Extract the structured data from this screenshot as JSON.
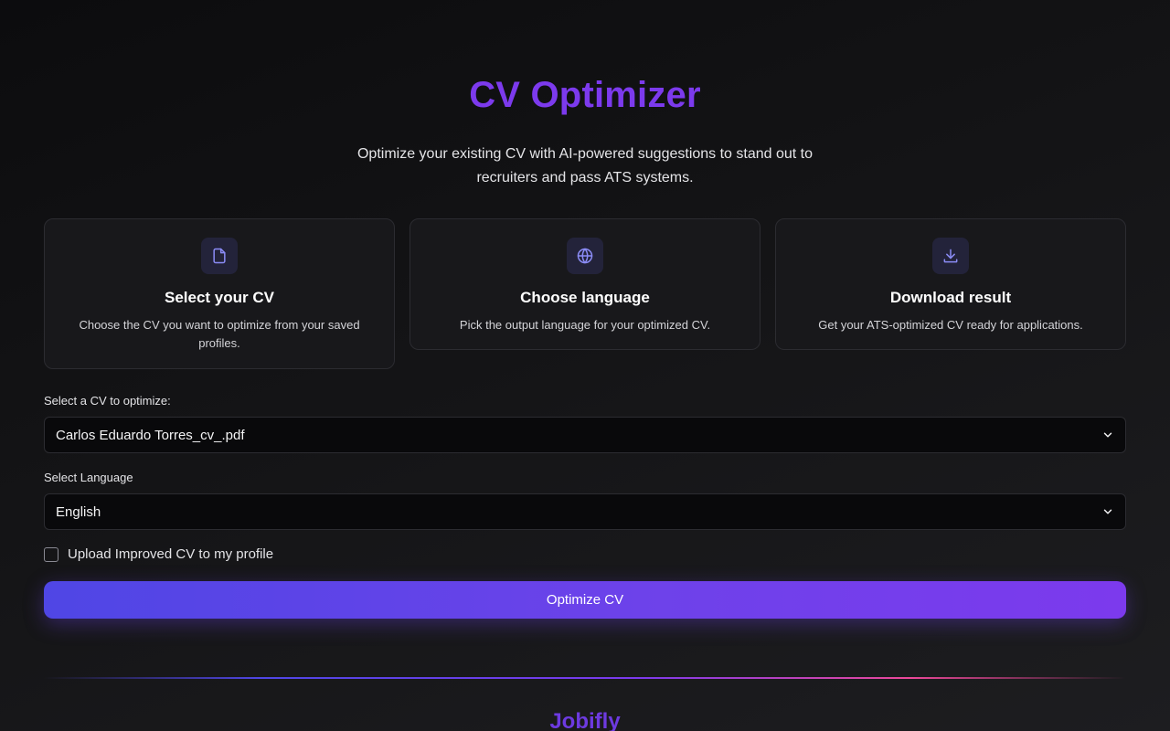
{
  "header": {
    "title": "CV Optimizer",
    "subtitle": "Optimize your existing CV with AI-powered suggestions to stand out to recruiters and pass ATS systems."
  },
  "steps": [
    {
      "icon": "file-icon",
      "title": "Select your CV",
      "description": "Choose the CV you want to optimize from your saved profiles."
    },
    {
      "icon": "globe-icon",
      "title": "Choose language",
      "description": "Pick the output language for your optimized CV."
    },
    {
      "icon": "download-icon",
      "title": "Download result",
      "description": "Get your ATS-optimized CV ready for applications."
    }
  ],
  "form": {
    "cv_label": "Select a CV to optimize:",
    "cv_selected": "Carlos Eduardo Torres_cv_.pdf",
    "language_label": "Select Language",
    "language_selected": "English",
    "upload_checkbox_label": "Upload Improved CV to my profile",
    "upload_checked": false,
    "submit_label": "Optimize CV"
  },
  "footer": {
    "brand": "Jobifly"
  },
  "colors": {
    "accent": "#7c3aed",
    "button_start": "#4f46e5",
    "button_end": "#7c3aed",
    "icon": "#8b8cf6"
  }
}
